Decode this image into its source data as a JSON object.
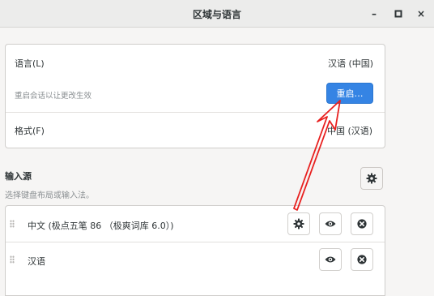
{
  "window": {
    "title": "区域与语言",
    "minimize": "–",
    "maximize": "▫",
    "close": "×"
  },
  "language": {
    "label": "语言(L)",
    "value": "汉语 (中国)",
    "restart_hint": "重启会话以让更改生效",
    "restart_button": "重启…"
  },
  "formats": {
    "label": "格式(F)",
    "value": "中国 (汉语)"
  },
  "input_sources": {
    "title": "输入源",
    "subtitle": "选择键盘布局或输入法。",
    "items": [
      {
        "label": "中文 (极点五笔 86 （极爽词库 6.0）)",
        "has_settings": true
      },
      {
        "label": "汉语",
        "has_settings": false
      }
    ]
  },
  "icons": {
    "settings": "gear-icon",
    "preview": "eye-icon",
    "remove": "remove-icon",
    "drag": "drag-handle-icon"
  },
  "colors": {
    "accent": "#3584e4",
    "annotation": "#e8201f"
  }
}
